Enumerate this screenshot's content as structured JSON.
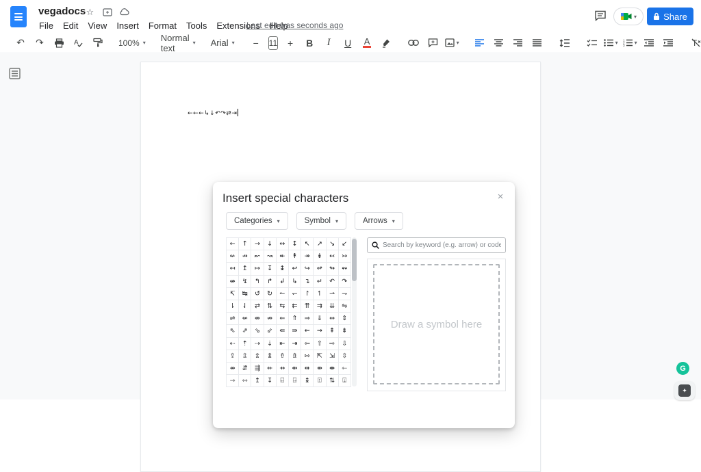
{
  "titlebar": {
    "doc_title": "vegadocs",
    "menu_items": [
      "File",
      "Edit",
      "View",
      "Insert",
      "Format",
      "Tools",
      "Extensions",
      "Help"
    ],
    "last_edit": "Last edit was seconds ago",
    "share_label": "Share"
  },
  "toolbar": {
    "zoom_value": "100%",
    "style_value": "Normal text",
    "font_value": "Arial",
    "font_size": "11",
    "minus": "−",
    "plus": "+",
    "bold": "B",
    "italic": "I",
    "underline": "U",
    "text_color": "A"
  },
  "icons": {
    "undo": "↶",
    "redo": "↷",
    "star": "☆",
    "caret": "▾",
    "collapse": "⌃",
    "close": "×",
    "grammarly": "G",
    "sparkle": "✦"
  },
  "document": {
    "text": "←←←↳↓↶↷⇄⇥"
  },
  "dialog": {
    "title": "Insert special characters",
    "filters": [
      "Categories",
      "Symbol",
      "Arrows"
    ],
    "search_placeholder": "Search by keyword (e.g. arrow) or code point",
    "draw_hint": "Draw a symbol here",
    "symbols": [
      "←",
      "↑",
      "→",
      "↓",
      "↔",
      "↕",
      "↖",
      "↗",
      "↘",
      "↙",
      "↚",
      "↛",
      "↜",
      "↝",
      "↞",
      "↟",
      "↠",
      "↡",
      "↢",
      "↣",
      "↤",
      "↥",
      "↦",
      "↧",
      "↨",
      "↩",
      "↪",
      "↫",
      "↬",
      "↭",
      "↮",
      "↯",
      "↰",
      "↱",
      "↲",
      "↳",
      "↴",
      "↵",
      "↶",
      "↷",
      "↸",
      "↹",
      "↺",
      "↻",
      "↼",
      "↽",
      "↾",
      "↿",
      "⇀",
      "⇁",
      "⇂",
      "⇃",
      "⇄",
      "⇅",
      "⇆",
      "⇇",
      "⇈",
      "⇉",
      "⇊",
      "⇋",
      "⇌",
      "⇍",
      "⇎",
      "⇏",
      "⇐",
      "⇑",
      "⇒",
      "⇓",
      "⇔",
      "⇕",
      "⇖",
      "⇗",
      "⇘",
      "⇙",
      "⇚",
      "⇛",
      "⇜",
      "⇝",
      "⇞",
      "⇟",
      "⇠",
      "⇡",
      "⇢",
      "⇣",
      "⇤",
      "⇥",
      "⇦",
      "⇧",
      "⇨",
      "⇩",
      "⇪",
      "⇫",
      "⇬",
      "⇭",
      "⇮",
      "⇯",
      "⇰",
      "⇱",
      "⇲",
      "⇳",
      "⇴",
      "⇵",
      "⇶",
      "⇷",
      "⇸",
      "⇹",
      "⇺",
      "⇻",
      "⇼",
      "⇽",
      "⇾",
      "⇿",
      "↥",
      "↧",
      "⍇",
      "⍈",
      "↨",
      "⍐",
      "⇅",
      "⍗"
    ]
  },
  "colors": {
    "accent_blue": "#1a73e8",
    "docs_blue": "#2684fc",
    "grammarly_green": "#15c39a",
    "toolbar_icon": "#444746"
  }
}
